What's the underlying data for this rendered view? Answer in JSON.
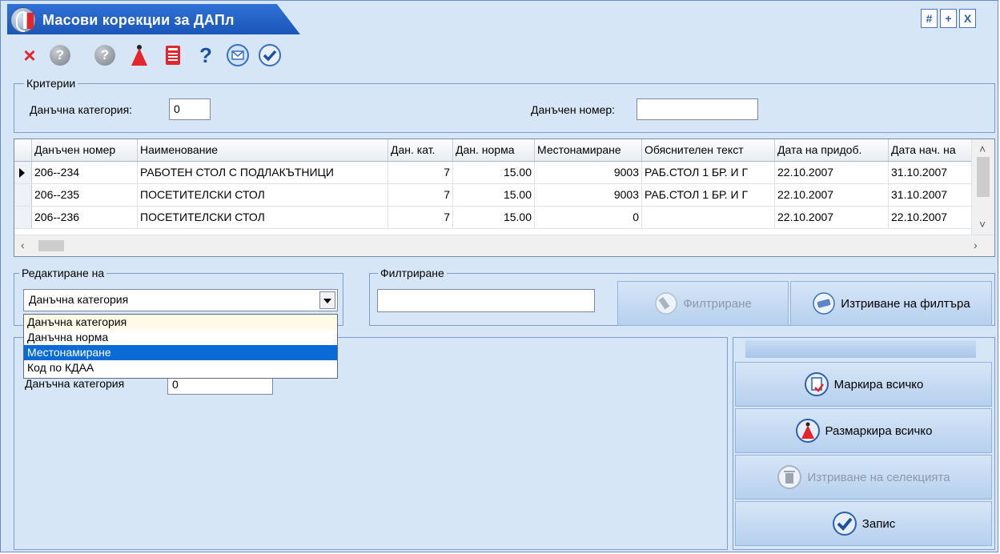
{
  "window": {
    "title": "Масови корекции за ДАПл",
    "controls": [
      "#",
      "+",
      "X"
    ]
  },
  "toolbar": {
    "icons": [
      "close-icon",
      "help-grey-icon",
      "help-grey-icon",
      "mark-triangle-icon",
      "calculator-icon",
      "question-icon",
      "email-icon",
      "check-icon"
    ]
  },
  "criteria": {
    "label": "Критерии",
    "tax_category_label": "Данъчна категория:",
    "tax_category_value": "0",
    "tax_number_label": "Данъчен номер:",
    "tax_number_value": ""
  },
  "grid": {
    "columns": [
      "Данъчен номер",
      "Наименование",
      "Дан. кат.",
      "Дан. норма",
      "Местонамиране",
      "Обяснителен текст",
      "Дата на придоб.",
      "Дата нач. на"
    ],
    "rows": [
      {
        "tax_number": "206--234",
        "name": "РАБОТЕН СТОЛ С ПОДЛАКЪТНИЦИ",
        "cat": "7",
        "rate": "15.00",
        "location": "9003",
        "text": "РАБ.СТОЛ 1 БР. И Г",
        "acq_date": "22.10.2007",
        "start_date": "31.10.2007"
      },
      {
        "tax_number": "206--235",
        "name": "ПОСЕТИТЕЛСКИ СТОЛ",
        "cat": "7",
        "rate": "15.00",
        "location": "9003",
        "text": "РАБ.СТОЛ 1 БР. И Г",
        "acq_date": "22.10.2007",
        "start_date": "31.10.2007"
      },
      {
        "tax_number": "206--236",
        "name": "ПОСЕТИТЕЛСКИ СТОЛ",
        "cat": "7",
        "rate": "15.00",
        "location": "0",
        "text": "",
        "acq_date": "22.10.2007",
        "start_date": "22.10.2007"
      }
    ]
  },
  "edit": {
    "label": "Редактиране на",
    "selected": "Данъчна категория",
    "options": [
      "Данъчна категория",
      "Данъчна норма",
      "Местонамиране",
      "Код по КДАА"
    ],
    "highlighted_index": 2,
    "field_label": "Данъчна категория",
    "field_value": "0"
  },
  "filter": {
    "label": "Филтриране",
    "input_value": "",
    "filter_button": "Филтриране",
    "clear_button": "Изтриване на филтъра"
  },
  "actions": {
    "mark_all": "Маркира всичко",
    "unmark_all": "Размаркира всичко",
    "delete_selection": "Изтриване на селекцията",
    "save": "Запис"
  },
  "colors": {
    "background": "#d7e6f6",
    "title_tab": "#2f71d6",
    "selection": "#0a6ad6",
    "accent_red": "#e2262c"
  }
}
